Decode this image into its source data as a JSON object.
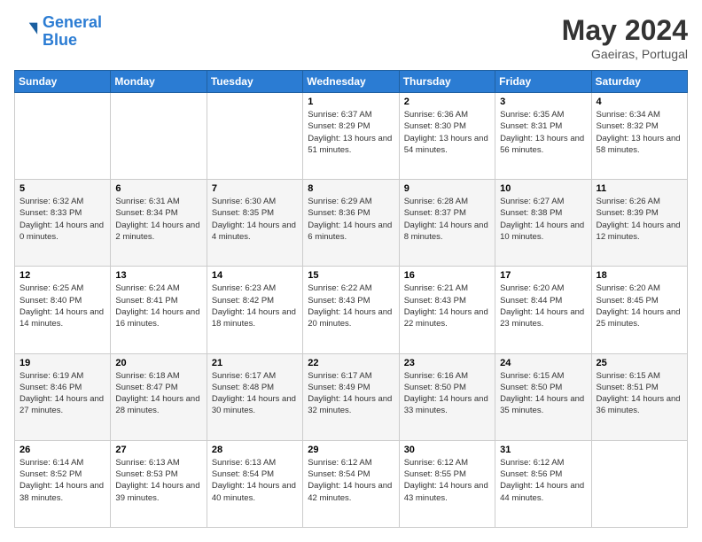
{
  "header": {
    "logo_line1": "General",
    "logo_line2": "Blue",
    "month_title": "May 2024",
    "location": "Gaeiras, Portugal"
  },
  "days_of_week": [
    "Sunday",
    "Monday",
    "Tuesday",
    "Wednesday",
    "Thursday",
    "Friday",
    "Saturday"
  ],
  "weeks": [
    [
      {
        "day": "",
        "info": ""
      },
      {
        "day": "",
        "info": ""
      },
      {
        "day": "",
        "info": ""
      },
      {
        "day": "1",
        "info": "Sunrise: 6:37 AM\nSunset: 8:29 PM\nDaylight: 13 hours\nand 51 minutes."
      },
      {
        "day": "2",
        "info": "Sunrise: 6:36 AM\nSunset: 8:30 PM\nDaylight: 13 hours\nand 54 minutes."
      },
      {
        "day": "3",
        "info": "Sunrise: 6:35 AM\nSunset: 8:31 PM\nDaylight: 13 hours\nand 56 minutes."
      },
      {
        "day": "4",
        "info": "Sunrise: 6:34 AM\nSunset: 8:32 PM\nDaylight: 13 hours\nand 58 minutes."
      }
    ],
    [
      {
        "day": "5",
        "info": "Sunrise: 6:32 AM\nSunset: 8:33 PM\nDaylight: 14 hours\nand 0 minutes."
      },
      {
        "day": "6",
        "info": "Sunrise: 6:31 AM\nSunset: 8:34 PM\nDaylight: 14 hours\nand 2 minutes."
      },
      {
        "day": "7",
        "info": "Sunrise: 6:30 AM\nSunset: 8:35 PM\nDaylight: 14 hours\nand 4 minutes."
      },
      {
        "day": "8",
        "info": "Sunrise: 6:29 AM\nSunset: 8:36 PM\nDaylight: 14 hours\nand 6 minutes."
      },
      {
        "day": "9",
        "info": "Sunrise: 6:28 AM\nSunset: 8:37 PM\nDaylight: 14 hours\nand 8 minutes."
      },
      {
        "day": "10",
        "info": "Sunrise: 6:27 AM\nSunset: 8:38 PM\nDaylight: 14 hours\nand 10 minutes."
      },
      {
        "day": "11",
        "info": "Sunrise: 6:26 AM\nSunset: 8:39 PM\nDaylight: 14 hours\nand 12 minutes."
      }
    ],
    [
      {
        "day": "12",
        "info": "Sunrise: 6:25 AM\nSunset: 8:40 PM\nDaylight: 14 hours\nand 14 minutes."
      },
      {
        "day": "13",
        "info": "Sunrise: 6:24 AM\nSunset: 8:41 PM\nDaylight: 14 hours\nand 16 minutes."
      },
      {
        "day": "14",
        "info": "Sunrise: 6:23 AM\nSunset: 8:42 PM\nDaylight: 14 hours\nand 18 minutes."
      },
      {
        "day": "15",
        "info": "Sunrise: 6:22 AM\nSunset: 8:43 PM\nDaylight: 14 hours\nand 20 minutes."
      },
      {
        "day": "16",
        "info": "Sunrise: 6:21 AM\nSunset: 8:43 PM\nDaylight: 14 hours\nand 22 minutes."
      },
      {
        "day": "17",
        "info": "Sunrise: 6:20 AM\nSunset: 8:44 PM\nDaylight: 14 hours\nand 23 minutes."
      },
      {
        "day": "18",
        "info": "Sunrise: 6:20 AM\nSunset: 8:45 PM\nDaylight: 14 hours\nand 25 minutes."
      }
    ],
    [
      {
        "day": "19",
        "info": "Sunrise: 6:19 AM\nSunset: 8:46 PM\nDaylight: 14 hours\nand 27 minutes."
      },
      {
        "day": "20",
        "info": "Sunrise: 6:18 AM\nSunset: 8:47 PM\nDaylight: 14 hours\nand 28 minutes."
      },
      {
        "day": "21",
        "info": "Sunrise: 6:17 AM\nSunset: 8:48 PM\nDaylight: 14 hours\nand 30 minutes."
      },
      {
        "day": "22",
        "info": "Sunrise: 6:17 AM\nSunset: 8:49 PM\nDaylight: 14 hours\nand 32 minutes."
      },
      {
        "day": "23",
        "info": "Sunrise: 6:16 AM\nSunset: 8:50 PM\nDaylight: 14 hours\nand 33 minutes."
      },
      {
        "day": "24",
        "info": "Sunrise: 6:15 AM\nSunset: 8:50 PM\nDaylight: 14 hours\nand 35 minutes."
      },
      {
        "day": "25",
        "info": "Sunrise: 6:15 AM\nSunset: 8:51 PM\nDaylight: 14 hours\nand 36 minutes."
      }
    ],
    [
      {
        "day": "26",
        "info": "Sunrise: 6:14 AM\nSunset: 8:52 PM\nDaylight: 14 hours\nand 38 minutes."
      },
      {
        "day": "27",
        "info": "Sunrise: 6:13 AM\nSunset: 8:53 PM\nDaylight: 14 hours\nand 39 minutes."
      },
      {
        "day": "28",
        "info": "Sunrise: 6:13 AM\nSunset: 8:54 PM\nDaylight: 14 hours\nand 40 minutes."
      },
      {
        "day": "29",
        "info": "Sunrise: 6:12 AM\nSunset: 8:54 PM\nDaylight: 14 hours\nand 42 minutes."
      },
      {
        "day": "30",
        "info": "Sunrise: 6:12 AM\nSunset: 8:55 PM\nDaylight: 14 hours\nand 43 minutes."
      },
      {
        "day": "31",
        "info": "Sunrise: 6:12 AM\nSunset: 8:56 PM\nDaylight: 14 hours\nand 44 minutes."
      },
      {
        "day": "",
        "info": ""
      }
    ]
  ]
}
